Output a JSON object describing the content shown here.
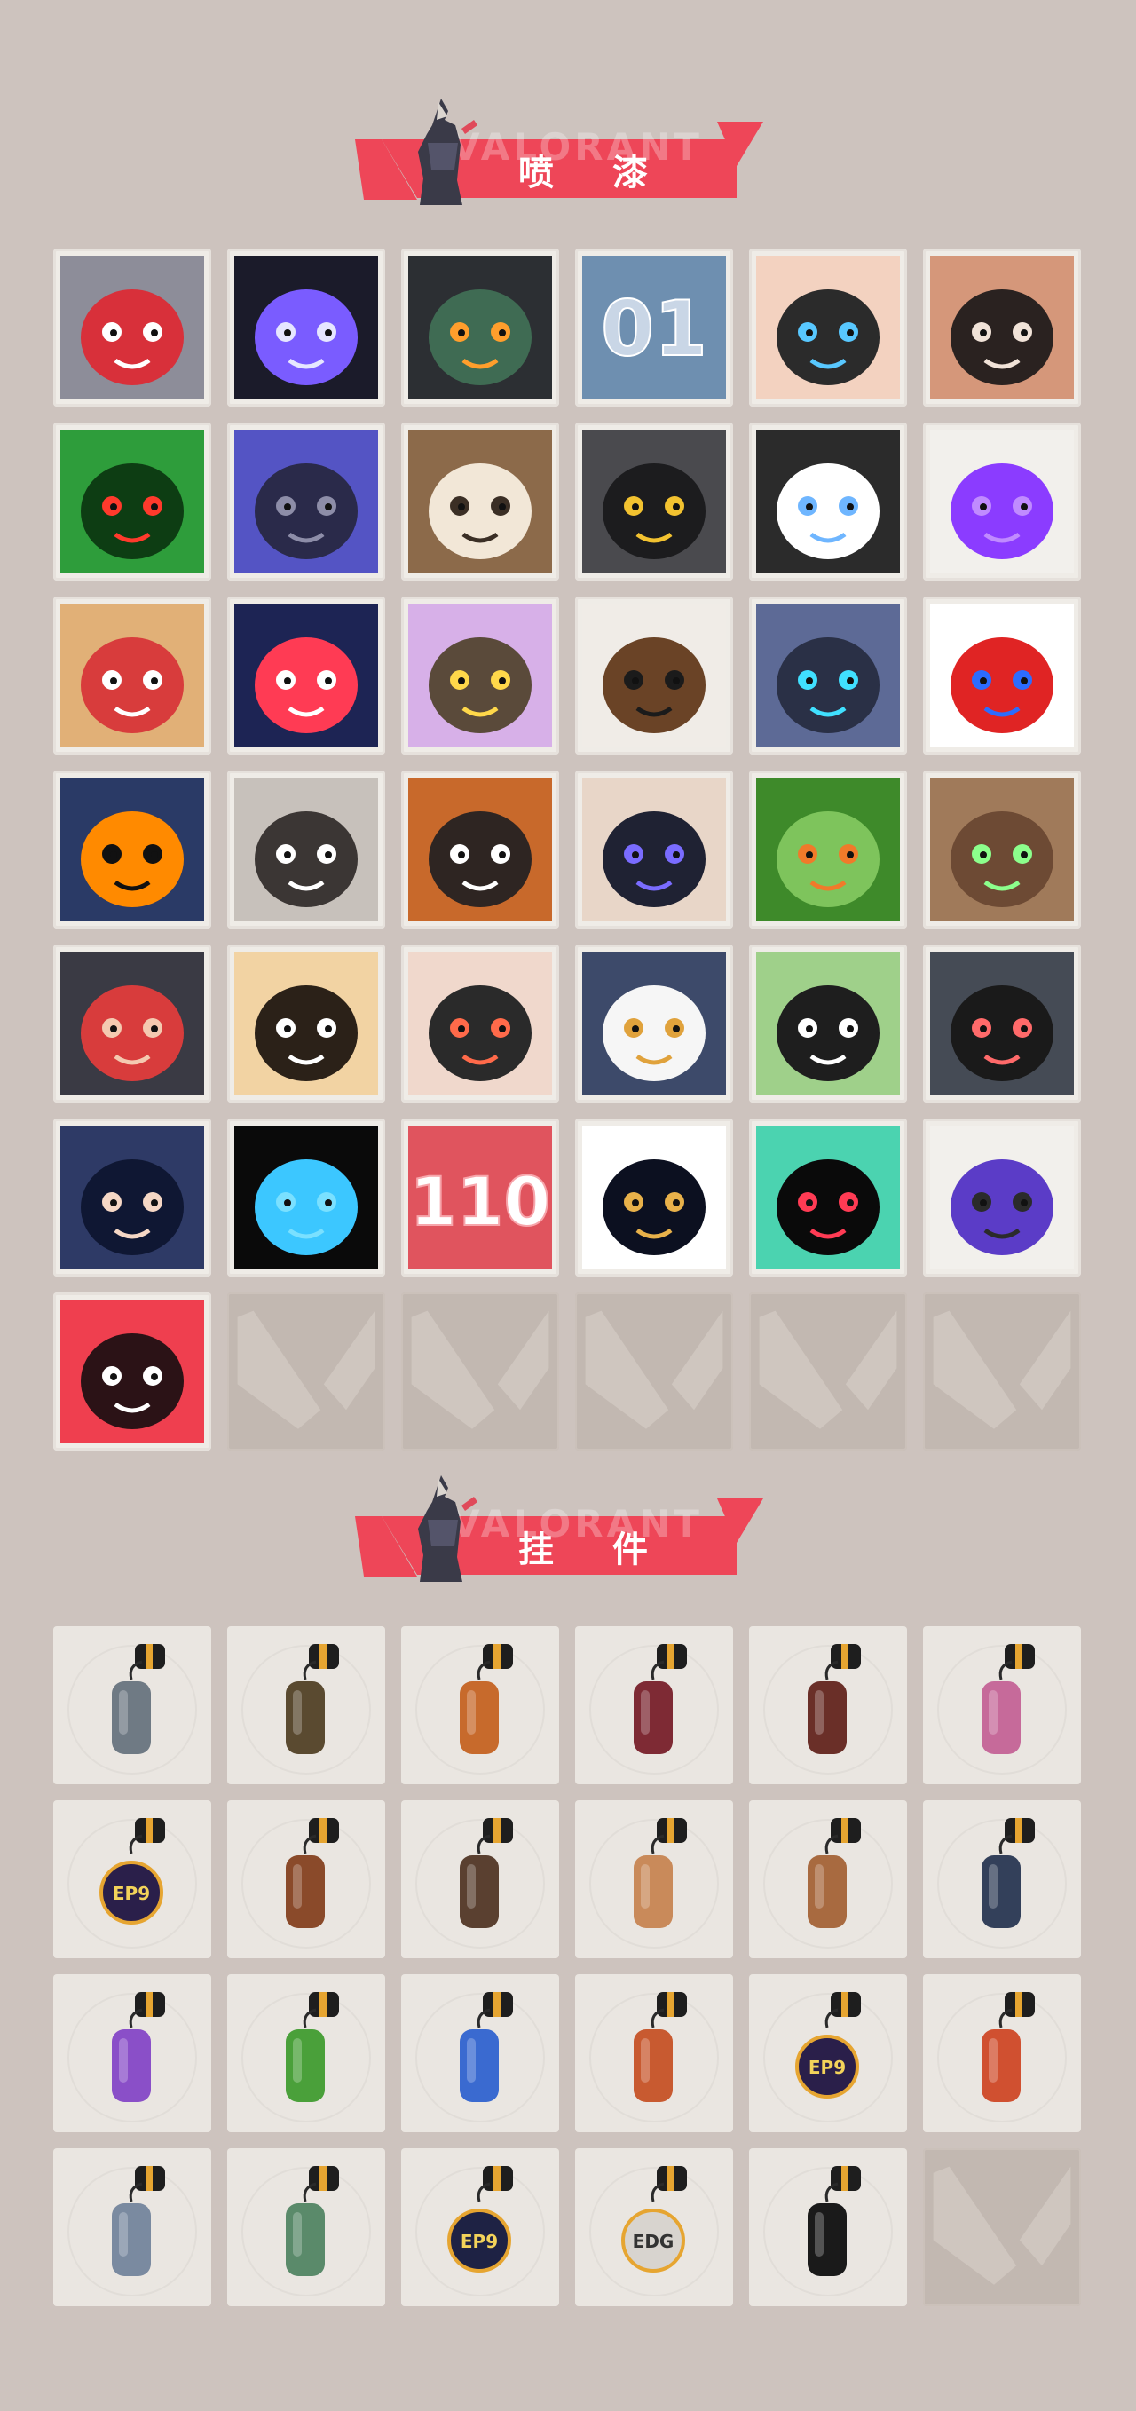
{
  "sections": {
    "sprays": {
      "title": "喷 漆",
      "watermark": "VALORANT"
    },
    "charms": {
      "title": "挂 件",
      "watermark": "VALORANT"
    }
  },
  "colors": {
    "background": "#cdc3be",
    "banner_red": "#ee4658",
    "tile_bg": "#efece7",
    "empty_tile": "#c2b8b1"
  },
  "sprays": [
    {
      "icon": "pixel-rat-headband-icon"
    },
    {
      "icon": "hooded-purple-face-icon"
    },
    {
      "icon": "green-robot-mask-icon"
    },
    {
      "icon": "number-01-badge-icon",
      "text": "01"
    },
    {
      "icon": "woman-butterfly-nose-icon"
    },
    {
      "icon": "angry-boy-face-icon"
    },
    {
      "icon": "green-gasmask-angry-icon"
    },
    {
      "icon": "purple-sniper-icon"
    },
    {
      "icon": "beanie-penguin-icon"
    },
    {
      "icon": "robot-yellow-eye-icon"
    },
    {
      "icon": "black-star-orb-icon"
    },
    {
      "icon": "purple-graffiti-tag-icon"
    },
    {
      "icon": "goggles-lion-icon"
    },
    {
      "icon": "chevron-stripes-icon"
    },
    {
      "icon": "sleeping-creature-icon"
    },
    {
      "icon": "pixel-mohawk-agent-icon"
    },
    {
      "icon": "armored-blue-helmet-icon"
    },
    {
      "icon": "clown-face-icon"
    },
    {
      "icon": "orange-dial-knob-icon"
    },
    {
      "icon": "raccoon-face-icon"
    },
    {
      "icon": "bearded-orange-cap-icon"
    },
    {
      "icon": "bandaged-boy-face-icon"
    },
    {
      "icon": "green-ammo-box-icon"
    },
    {
      "icon": "green-eyed-creature-icon"
    },
    {
      "icon": "crying-mole-icon"
    },
    {
      "icon": "sleepy-tiger-icon"
    },
    {
      "icon": "girl-pencil-face-icon"
    },
    {
      "icon": "penguin-beanie-icon"
    },
    {
      "icon": "frog-top-hat-icon"
    },
    {
      "icon": "grey-cat-laughing-icon"
    },
    {
      "icon": "hooded-agent-portrait-icon"
    },
    {
      "icon": "blue-drop-eyes-icon"
    },
    {
      "icon": "number-110-badge-icon",
      "text": "110"
    },
    {
      "icon": "gold-silhouette-agent-icon"
    },
    {
      "icon": "valorant-logo-splatter-icon"
    },
    {
      "icon": "purple-drip-graffiti-icon"
    },
    {
      "icon": "valorant-red-circle-icon"
    },
    {
      "icon": "empty-slot-icon",
      "empty": true
    },
    {
      "icon": "empty-slot-icon",
      "empty": true
    },
    {
      "icon": "empty-slot-icon",
      "empty": true
    },
    {
      "icon": "empty-slot-icon",
      "empty": true
    },
    {
      "icon": "empty-slot-icon",
      "empty": true
    }
  ],
  "charms": [
    {
      "icon": "raccoon-charm-icon"
    },
    {
      "icon": "canteen-charm-icon"
    },
    {
      "icon": "potion-bottle-charm-icon"
    },
    {
      "icon": "chainsaw-blade-charm-icon"
    },
    {
      "icon": "beaded-cord-charm-icon"
    },
    {
      "icon": "cupcake-charm-icon"
    },
    {
      "icon": "ep9-coin-charm-icon",
      "text": "EP9"
    },
    {
      "icon": "teddy-bear-charm-icon"
    },
    {
      "icon": "wooden-gun-charm-icon"
    },
    {
      "icon": "agent-figure-charm-icon"
    },
    {
      "icon": "crate-charm-icon"
    },
    {
      "icon": "robot-bird-charm-icon"
    },
    {
      "icon": "lava-lamp-charm-icon"
    },
    {
      "icon": "green-pager-charm-icon"
    },
    {
      "icon": "astronaut-charm-icon"
    },
    {
      "icon": "radio-device-charm-icon"
    },
    {
      "icon": "ep9-coin-charm-icon",
      "text": "EP9"
    },
    {
      "icon": "candy-skewer-charm-icon"
    },
    {
      "icon": "agent-bust-charm-icon"
    },
    {
      "icon": "robot-cart-charm-icon"
    },
    {
      "icon": "ep9-gold-coin-charm-icon",
      "text": "EP9"
    },
    {
      "icon": "edg-badge-charm-icon",
      "text": "EDG"
    },
    {
      "icon": "valorant-coin-charm-icon"
    },
    {
      "icon": "empty-slot-icon",
      "empty": true
    }
  ]
}
